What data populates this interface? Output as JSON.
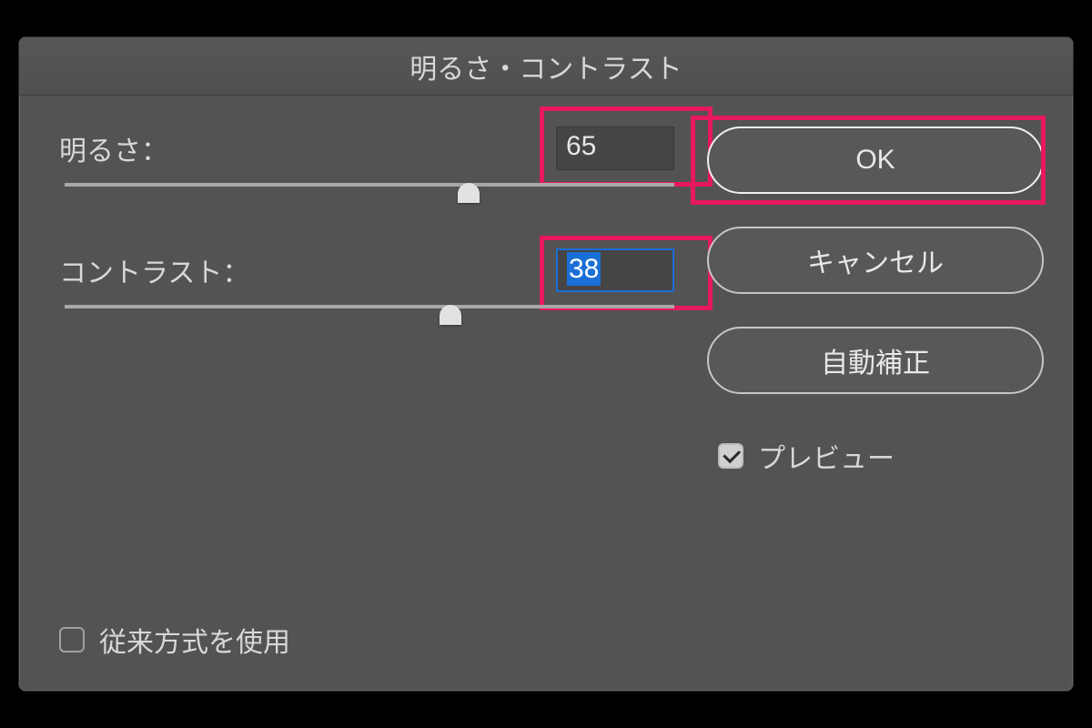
{
  "dialog": {
    "title": "明るさ・コントラスト",
    "brightness": {
      "label": "明るさ：",
      "value": "65",
      "sliderPercent": 66
    },
    "contrast": {
      "label": "コントラスト：",
      "value": "38",
      "sliderPercent": 63,
      "selected": true
    },
    "legacy": {
      "label": "従来方式を使用",
      "checked": false
    },
    "buttons": {
      "ok": "OK",
      "cancel": "キャンセル",
      "auto": "自動補正"
    },
    "preview": {
      "label": "プレビュー",
      "checked": true
    },
    "highlight_color": "#e6195e"
  }
}
